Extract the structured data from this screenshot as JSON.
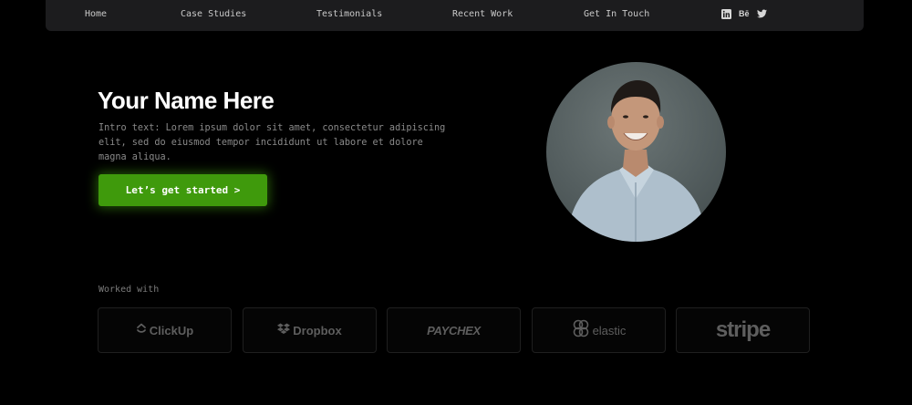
{
  "nav": {
    "items": [
      {
        "label": "Home"
      },
      {
        "label": "Case Studies"
      },
      {
        "label": "Testimonials"
      },
      {
        "label": "Recent Work"
      },
      {
        "label": "Get In Touch"
      }
    ],
    "social": [
      {
        "icon": "linkedin-icon"
      },
      {
        "icon": "behance-icon",
        "label": "Bē"
      },
      {
        "icon": "twitter-icon"
      }
    ]
  },
  "hero": {
    "title": "Your Name Here",
    "intro": "Intro text: Lorem ipsum dolor sit amet, consectetur adipiscing elit, sed do eiusmod tempor incididunt ut labore et dolore magna aliqua.",
    "cta_label": "Let’s get started >",
    "accent_color": "#3f9a0c"
  },
  "worked_with": {
    "heading": "Worked with",
    "logos": [
      {
        "name": "ClickUp",
        "icon": "clickup-icon"
      },
      {
        "name": "Dropbox",
        "icon": "dropbox-icon"
      },
      {
        "name": "PAYCHEX"
      },
      {
        "name": "elastic",
        "icon": "elastic-icon"
      },
      {
        "name": "stripe"
      }
    ]
  },
  "colors": {
    "background": "#000000",
    "nav_background": "#1c1c1e",
    "logo_gray": "#5e5e5e"
  }
}
